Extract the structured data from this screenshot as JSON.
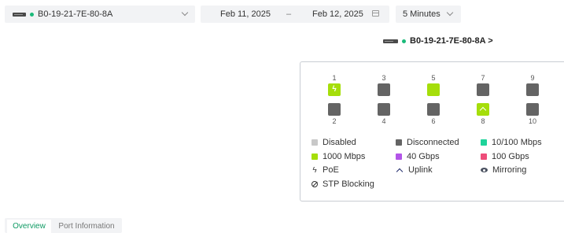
{
  "filters": {
    "device": "B0-19-21-7E-80-8A",
    "start_date": "Feb 11, 2025",
    "separator": "–",
    "end_date": "Feb 12, 2025",
    "interval": "5 Minutes"
  },
  "device_header": {
    "label": "B0-19-21-7E-80-8A >"
  },
  "ports": [
    {
      "number": "1",
      "state": "1000 Mbps",
      "poe": true,
      "uplink": false
    },
    {
      "number": "2",
      "state": "Disconnected",
      "poe": false,
      "uplink": false
    },
    {
      "number": "3",
      "state": "Disconnected",
      "poe": false,
      "uplink": false
    },
    {
      "number": "4",
      "state": "Disconnected",
      "poe": false,
      "uplink": false
    },
    {
      "number": "5",
      "state": "1000 Mbps",
      "poe": false,
      "uplink": false
    },
    {
      "number": "6",
      "state": "Disconnected",
      "poe": false,
      "uplink": false
    },
    {
      "number": "7",
      "state": "Disconnected",
      "poe": false,
      "uplink": false
    },
    {
      "number": "8",
      "state": "1000 Mbps",
      "poe": false,
      "uplink": true
    },
    {
      "number": "9",
      "state": "Disconnected",
      "poe": false,
      "uplink": false
    },
    {
      "number": "10",
      "state": "Disconnected",
      "poe": false,
      "uplink": false
    }
  ],
  "legend": {
    "disabled": "Disabled",
    "disconnected": "Disconnected",
    "speed_10_100": "10/100 Mbps",
    "speed_1000": "1000 Mbps",
    "speed_40g": "40 Gbps",
    "speed_100g": "100 Gbps",
    "poe": "PoE",
    "uplink": "Uplink",
    "mirroring": "Mirroring",
    "stp_blocking": "STP Blocking"
  },
  "legend_colors": {
    "disabled": "#c8c8c8",
    "disconnected": "#646464",
    "speed_10_100": "#1ed39a",
    "speed_1000": "#a5de0a",
    "speed_40g": "#b355e8",
    "speed_100g": "#ee4d7a"
  },
  "icons": {
    "poe": "lightning-icon",
    "uplink": "chevron-up-icon",
    "mirroring": "eye-icon",
    "stp_blocking": "block-icon"
  },
  "tabs": [
    {
      "label": "Overview",
      "active": true
    },
    {
      "label": "Port Information",
      "active": false
    }
  ]
}
